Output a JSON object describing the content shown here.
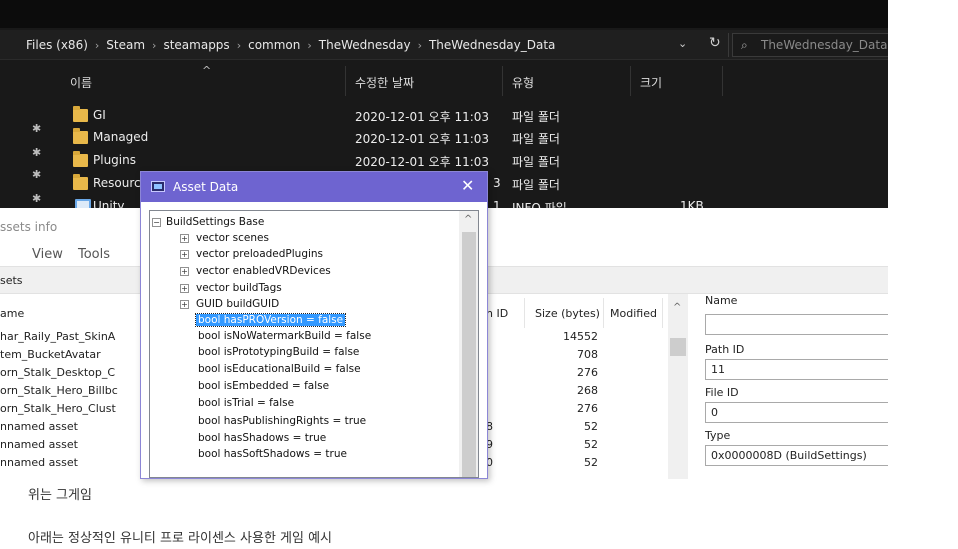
{
  "explorer": {
    "breadcrumb": [
      "Files (x86)",
      "Steam",
      "steamapps",
      "common",
      "TheWednesday",
      "TheWednesday_Data"
    ],
    "search_placeholder": "TheWednesday_Data",
    "columns": {
      "name": "이름",
      "modified": "수정한 날짜",
      "type": "유형",
      "size": "크기"
    },
    "rows": [
      {
        "name": "GI",
        "modified": "2020-12-01 오후 11:03",
        "type": "파일 폴더",
        "size": ""
      },
      {
        "name": "Managed",
        "modified": "2020-12-01 오후 11:03",
        "type": "파일 폴더",
        "size": ""
      },
      {
        "name": "Plugins",
        "modified": "2020-12-01 오후 11:03",
        "type": "파일 폴더",
        "size": ""
      },
      {
        "name": "Resourc",
        "modified": "3",
        "type": "파일 폴더",
        "size": ""
      },
      {
        "name": "Unity",
        "modified": "1",
        "type": "INFO 파일",
        "size": "1KB"
      }
    ]
  },
  "uabe": {
    "title": "ssets info",
    "menu": [
      "View",
      "Tools"
    ],
    "assets_label": "sets",
    "table": {
      "headers": {
        "name": "ame",
        "path_id": "h ID",
        "size": "Size (bytes)",
        "modified": "Modified"
      },
      "rows": [
        {
          "name": "har_Raily_Past_SkinA",
          "path_id": "",
          "size": "14552"
        },
        {
          "name": "tem_BucketAvatar",
          "path_id": "",
          "size": "708"
        },
        {
          "name": "orn_Stalk_Desktop_C",
          "path_id": "",
          "size": "276"
        },
        {
          "name": "orn_Stalk_Hero_Billbc",
          "path_id": "",
          "size": "268"
        },
        {
          "name": "orn_Stalk_Hero_Clust",
          "path_id": "",
          "size": "276"
        },
        {
          "name": "nnamed asset",
          "path_id": "8",
          "size": "52"
        },
        {
          "name": "nnamed asset",
          "path_id": "9",
          "size": "52"
        },
        {
          "name": "nnamed asset",
          "path_id": "0",
          "size": "52"
        }
      ]
    },
    "props": {
      "name_label": "Name",
      "name_value": "",
      "path_id_label": "Path ID",
      "path_id_value": "11",
      "file_id_label": "File ID",
      "file_id_value": "0",
      "type_label": "Type",
      "type_value": "0x0000008D (BuildSettings)"
    }
  },
  "dialog": {
    "title": "Asset Data",
    "close": "✕",
    "root": "BuildSettings Base",
    "nodes": [
      "vector scenes",
      "vector preloadedPlugins",
      "vector enabledVRDevices",
      "vector buildTags",
      "GUID buildGUID"
    ],
    "leaves": [
      "bool hasPROVersion = false",
      "bool isNoWatermarkBuild = false",
      "bool isPrototypingBuild = false",
      "bool isEducationalBuild = false",
      "bool isEmbedded = false",
      "bool isTrial = false",
      "bool hasPublishingRights = true",
      "bool hasShadows = true",
      "bool hasSoftShadows = true"
    ]
  },
  "captions": {
    "line1": "위는 그게임",
    "line2": "아래는 정상적인 유니티 프로 라이센스 사용한 게임 예시"
  }
}
